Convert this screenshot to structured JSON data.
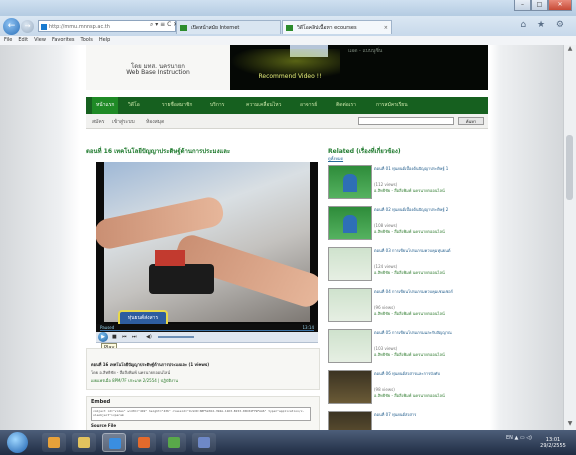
{
  "browser": {
    "address": "http://mmu.mnnsp.ac.th",
    "address_buttons": "⌕ ▾ ≡ C ✕",
    "tabs": [
      {
        "label": "เปิดหน้าสมัย Internet"
      },
      {
        "label": "วิดีโอคลิปเนื้อหา ecourses"
      }
    ],
    "tab_close": "×",
    "back_glyph": "←",
    "forward_glyph": "→",
    "home_buttons": "⌂ ★ ⚙",
    "window_buttons": [
      "–",
      "□",
      "✕"
    ],
    "menu": [
      "File",
      "Edit",
      "View",
      "Favorites",
      "Tools",
      "Help"
    ]
  },
  "banner": {
    "line1": "โดย มทส. นครนายก",
    "line2": "Web Base Instruction",
    "recommend": "Recommend Video !!",
    "small_text": "แอด - แบบนูซิ่น"
  },
  "site_nav": [
    "หน้าแรก",
    "วิดีโอ",
    "รายชื่อสมาชิก",
    "บริการ",
    "ความเคลื่อนไหว",
    "อาจารย์",
    "ติดต่อเรา",
    "การสมัครเรียน"
  ],
  "sub_nav": [
    "สมัคร",
    "เข้าสู่ระบบ",
    "ห้องสมุด"
  ],
  "search_button": "ค้นหา",
  "video": {
    "title": "ตอนที่ 16 เทคโนโลยีปัญญาประดิษฐ์ด้านการประมงและ",
    "sticker": "หุ่นยนต์ส่งสาร",
    "status": "Paused",
    "time": "13:14",
    "progress": 0.0,
    "volume": 0.7,
    "tooltip": "Play",
    "info_title": "ตอนที่ 16 เทคโนโลยีปัญญาประดิษฐ์ด้านการประมงและ (1 views)",
    "info_by": "โดย อ.สิทธิชัย - สื่อสิ่งพิมพ์ นครนายกออนไลน์",
    "info_meta": "เผยแพร่เมื่อ 8PM/7F ประเภท 2/2554 | ปฏิบัติงาน"
  },
  "embed": {
    "label": "Embed",
    "code": "<object id=\"video\" width=\"492\" height=\"436\" classid=\"CLSID:6BF52A52-394A-11D3-B153-00C04F79FAA6\" type=\"application/x-oleobject\"><param",
    "source_label": "Source File"
  },
  "related": {
    "heading": "Related (เรื่องที่เกี่ยวข้อง)",
    "sub": "ดูทั้งหมด",
    "items": [
      {
        "title": "ตอนที่ 01 หุ่นยนต์เบื้องต้นปัญญาประดิษฐ์ 1",
        "views": "(112 views)",
        "author": "อ.สิทธิชัย - สื่อสิ่งพิมพ์ นครนายกออนไลน์"
      },
      {
        "title": "ตอนที่ 02 หุ่นยนต์เบื้องต้นปัญญาประดิษฐ์ 2",
        "views": "(108 views)",
        "author": "อ.สิทธิชัย - สื่อสิ่งพิมพ์ นครนายกออนไลน์"
      },
      {
        "title": "ตอนที่ 03 การเขียนโปรแกรมควบคุมหุ่นยนต์",
        "views": "(124 views)",
        "author": "อ.สิทธิชัย - สื่อสิ่งพิมพ์ นครนายกออนไลน์"
      },
      {
        "title": "ตอนที่ 04 การเขียนโปรแกรมควบคุมเซนเซอร์",
        "views": "(96 views)",
        "author": "อ.สิทธิชัย - สื่อสิ่งพิมพ์ นครนายกออนไลน์"
      },
      {
        "title": "ตอนที่ 05 การเขียนโปรแกรมและรับสัญญาณ",
        "views": "(103 views)",
        "author": "อ.สิทธิชัย - สื่อสิ่งพิมพ์ นครนายกออนไลน์"
      },
      {
        "title": "ตอนที่ 06 หุ่นยนต์ส่งสารและการบังคับ",
        "views": "(98 views)",
        "author": "อ.สิทธิชัย - สื่อสิ่งพิมพ์ นครนายกออนไลน์"
      },
      {
        "title": "ตอนที่ 07 หุ่นยนต์ส่งสาร",
        "views": "",
        "author": ""
      }
    ]
  },
  "taskbar": {
    "tray": "EN ▲ ▭ ◁)",
    "time": "13:01",
    "date": "29/2/2555"
  },
  "scrollbar_arrows": [
    "▲",
    "▼"
  ],
  "colors": {
    "nav_green": "#16601f",
    "accent_green": "#1f7a2e",
    "banner_dark": "#050805"
  }
}
